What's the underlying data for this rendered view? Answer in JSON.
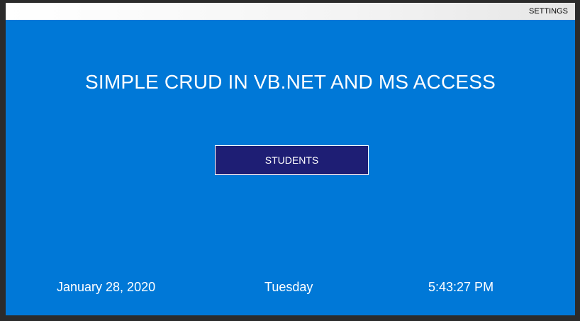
{
  "menubar": {
    "settings_label": "SETTINGS"
  },
  "main": {
    "title": "SIMPLE CRUD IN VB.NET AND MS ACCESS",
    "students_button_label": "STUDENTS"
  },
  "status": {
    "date": "January 28, 2020",
    "day": "Tuesday",
    "time": "5:43:27 PM"
  },
  "colors": {
    "background": "#0078d7",
    "button": "#1e1e74",
    "text": "#ffffff"
  }
}
